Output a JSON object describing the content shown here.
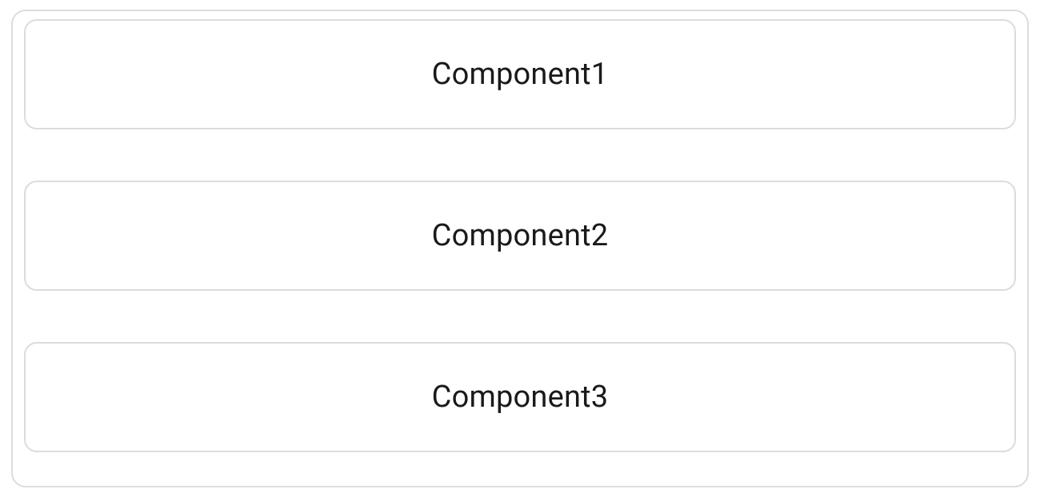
{
  "components": [
    {
      "label": "Component1"
    },
    {
      "label": "Component2"
    },
    {
      "label": "Component3"
    }
  ]
}
